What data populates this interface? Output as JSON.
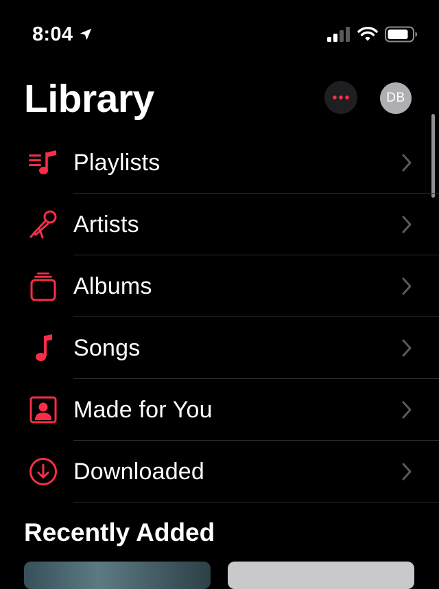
{
  "status_bar": {
    "time": "8:04",
    "location_icon": "location-arrow-icon",
    "signal_icon": "cellular-signal-icon",
    "wifi_icon": "wifi-icon",
    "battery_icon": "battery-icon"
  },
  "header": {
    "title": "Library",
    "more_icon": "ellipsis-icon",
    "avatar_initials": "DB"
  },
  "library": {
    "items": [
      {
        "label": "Playlists",
        "icon": "playlist-icon"
      },
      {
        "label": "Artists",
        "icon": "microphone-icon"
      },
      {
        "label": "Albums",
        "icon": "album-stack-icon"
      },
      {
        "label": "Songs",
        "icon": "music-note-icon"
      },
      {
        "label": "Made for You",
        "icon": "person-square-icon"
      },
      {
        "label": "Downloaded",
        "icon": "download-circle-icon"
      }
    ],
    "chevron_icon": "chevron-right-icon"
  },
  "recently_added": {
    "title": "Recently Added"
  },
  "colors": {
    "accent": "#fa2d48",
    "background": "#000000",
    "text": "#ffffff",
    "chevron": "#5a5a5e",
    "divider": "#2c2c2e",
    "avatar_bg": "#aeaeb3",
    "more_button_bg": "#1f1f21"
  }
}
